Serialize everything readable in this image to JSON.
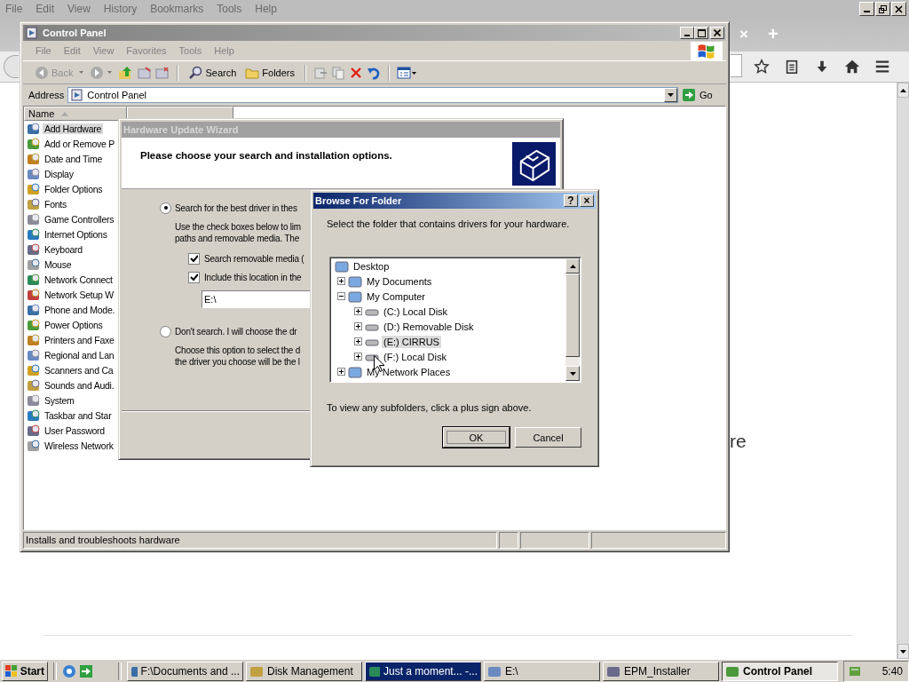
{
  "browser": {
    "menu": [
      "File",
      "Edit",
      "View",
      "History",
      "Bookmarks",
      "Tools",
      "Help"
    ],
    "tab_close": "×",
    "new_tab": "+",
    "page_text": "re"
  },
  "control_panel": {
    "title": "Control Panel",
    "menu": [
      "File",
      "Edit",
      "View",
      "Favorites",
      "Tools",
      "Help"
    ],
    "toolbar": {
      "back": "Back",
      "search": "Search",
      "folders": "Folders"
    },
    "address": {
      "label": "Address",
      "value": "Control Panel",
      "go": "Go"
    },
    "columns": [
      "Name"
    ],
    "items": [
      {
        "label": "Add Hardware",
        "selected": true
      },
      {
        "label": "Add or Remove P",
        "selected": false
      },
      {
        "label": "Date and Time",
        "selected": false
      },
      {
        "label": "Display",
        "selected": false
      },
      {
        "label": "Folder Options",
        "selected": false
      },
      {
        "label": "Fonts",
        "selected": false
      },
      {
        "label": "Game Controllers",
        "selected": false
      },
      {
        "label": "Internet Options",
        "selected": false
      },
      {
        "label": "Keyboard",
        "selected": false
      },
      {
        "label": "Mouse",
        "selected": false
      },
      {
        "label": "Network Connect",
        "selected": false
      },
      {
        "label": "Network Setup W",
        "selected": false
      },
      {
        "label": "Phone and Mode.",
        "selected": false
      },
      {
        "label": "Power Options",
        "selected": false
      },
      {
        "label": "Printers and Faxe",
        "selected": false
      },
      {
        "label": "Regional and Lan",
        "selected": false
      },
      {
        "label": "Scanners and Ca",
        "selected": false
      },
      {
        "label": "Sounds and Audi.",
        "selected": false
      },
      {
        "label": "System",
        "selected": false
      },
      {
        "label": "Taskbar and Star",
        "selected": false
      },
      {
        "label": "User Password",
        "selected": false
      },
      {
        "label": "Wireless Network",
        "selected": false
      }
    ],
    "status": "Installs and troubleshoots hardware"
  },
  "wizard": {
    "title": "Hardware Update Wizard",
    "heading": "Please choose your search and installation options.",
    "options": [
      {
        "label": "Search for the best driver in thes",
        "selected": true,
        "description": [
          "Use the check boxes below to lim",
          "paths and removable media. The"
        ]
      },
      {
        "label": "Don't search. I will choose the dr",
        "selected": false,
        "description": [
          "Choose this option to select the d",
          "the driver you choose will be the l"
        ]
      }
    ],
    "checkboxes": [
      {
        "label": "Search removable media (",
        "checked": true
      },
      {
        "label": "Include this location in the",
        "checked": true
      }
    ],
    "location": "E:\\"
  },
  "browse_dialog": {
    "title": "Browse For Folder",
    "help": "?",
    "close": "×",
    "prompt": "Select the folder that contains drivers for your hardware.",
    "tree": [
      {
        "label": "Desktop",
        "selected": false,
        "children": [
          {
            "label": "My Documents",
            "expanded": false,
            "selected": false
          },
          {
            "label": "My Computer",
            "expanded": true,
            "selected": false,
            "children": [
              {
                "label": "(C:) Local Disk",
                "expanded": false,
                "selected": false
              },
              {
                "label": "(D:) Removable Disk",
                "expanded": false,
                "selected": false
              },
              {
                "label": "(E:) CIRRUS",
                "expanded": false,
                "selected": true
              },
              {
                "label": "(F:) Local Disk",
                "expanded": false,
                "selected": false
              }
            ]
          },
          {
            "label": "My Network Places",
            "expanded": false,
            "selected": false
          }
        ]
      }
    ],
    "hint": "To view any subfolders, click a plus sign above.",
    "ok": "OK",
    "cancel": "Cancel"
  },
  "taskbar": {
    "start": "Start",
    "tasks": [
      {
        "label": "F:\\Documents and ...",
        "selected": false,
        "flashing": false
      },
      {
        "label": "Disk Management",
        "selected": false,
        "flashing": false
      },
      {
        "label": "Just a moment... -...",
        "selected": false,
        "flashing": true
      },
      {
        "label": "E:\\",
        "selected": false,
        "flashing": false
      },
      {
        "label": "EPM_Installer",
        "selected": false,
        "flashing": false
      },
      {
        "label": "Control Panel",
        "selected": true,
        "flashing": false
      }
    ],
    "clock": "5:40"
  }
}
